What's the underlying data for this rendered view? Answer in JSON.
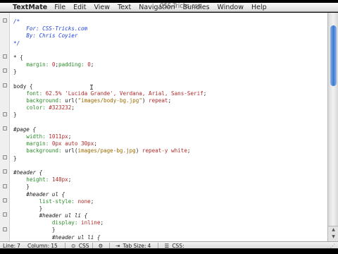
{
  "menubar": {
    "apple_glyph": "",
    "app_name": "TextMate",
    "items": [
      "File",
      "Edit",
      "View",
      "Text",
      "Navigation",
      "Bundles",
      "Window",
      "Help"
    ],
    "window_title": "CSS-Tricks.css"
  },
  "code_lines": [
    [
      {
        "t": "/*",
        "c": "cm"
      }
    ],
    [
      {
        "t": "    For: CSS-Tricks.com",
        "c": "cm"
      }
    ],
    [
      {
        "t": "    By: Chris Coyier",
        "c": "cm"
      }
    ],
    [
      {
        "t": "*/",
        "c": "cm"
      }
    ],
    [],
    [
      {
        "t": "* {",
        "c": "sel"
      }
    ],
    [
      {
        "t": "    margin: ",
        "c": "prop"
      },
      {
        "t": "0",
        "c": "val"
      },
      {
        "t": ";",
        "c": "plain"
      },
      {
        "t": "padding: ",
        "c": "prop"
      },
      {
        "t": "0",
        "c": "val"
      },
      {
        "t": ";",
        "c": "plain"
      }
    ],
    [
      {
        "t": "}",
        "c": "plain"
      }
    ],
    [],
    [
      {
        "t": "body {",
        "c": "sel"
      }
    ],
    [
      {
        "t": "    font: ",
        "c": "prop"
      },
      {
        "t": "62.5% 'Lucida Grande', Verdana, Arial, Sans-Serif",
        "c": "val"
      },
      {
        "t": ";",
        "c": "plain"
      }
    ],
    [
      {
        "t": "    background: ",
        "c": "prop"
      },
      {
        "t": "url(",
        "c": "plain"
      },
      {
        "t": "\"images/body-bg.jpg\"",
        "c": "str"
      },
      {
        "t": ") ",
        "c": "plain"
      },
      {
        "t": "repeat",
        "c": "val"
      },
      {
        "t": ";",
        "c": "plain"
      }
    ],
    [
      {
        "t": "    color: ",
        "c": "prop"
      },
      {
        "t": "#323232",
        "c": "val"
      },
      {
        "t": ";",
        "c": "plain"
      }
    ],
    [
      {
        "t": "}",
        "c": "plain"
      }
    ],
    [],
    [
      {
        "t": "#page {",
        "c": "selid"
      }
    ],
    [
      {
        "t": "    width: ",
        "c": "prop"
      },
      {
        "t": "1011px",
        "c": "val"
      },
      {
        "t": ";",
        "c": "plain"
      }
    ],
    [
      {
        "t": "    margin: ",
        "c": "prop"
      },
      {
        "t": "0px auto 30px",
        "c": "val"
      },
      {
        "t": ";",
        "c": "plain"
      }
    ],
    [
      {
        "t": "    background: ",
        "c": "prop"
      },
      {
        "t": "url(",
        "c": "plain"
      },
      {
        "t": "images/page-bg.jpg",
        "c": "str"
      },
      {
        "t": ") ",
        "c": "plain"
      },
      {
        "t": "repeat-y white",
        "c": "val"
      },
      {
        "t": ";",
        "c": "plain"
      }
    ],
    [
      {
        "t": "}",
        "c": "plain"
      }
    ],
    [],
    [
      {
        "t": "#header {",
        "c": "selid"
      }
    ],
    [
      {
        "t": "    height: ",
        "c": "prop"
      },
      {
        "t": "148px",
        "c": "val"
      },
      {
        "t": ";",
        "c": "plain"
      }
    ],
    [
      {
        "t": "    }",
        "c": "plain"
      }
    ],
    [
      {
        "t": "    #header ul {",
        "c": "selid"
      }
    ],
    [
      {
        "t": "        list-style: ",
        "c": "prop"
      },
      {
        "t": "none",
        "c": "val"
      },
      {
        "t": ";",
        "c": "plain"
      }
    ],
    [
      {
        "t": "        }",
        "c": "plain"
      }
    ],
    [
      {
        "t": "        #header ul li {",
        "c": "selid"
      }
    ],
    [
      {
        "t": "            display: ",
        "c": "prop"
      },
      {
        "t": "inline",
        "c": "val"
      },
      {
        "t": ";",
        "c": "plain"
      }
    ],
    [
      {
        "t": "            }",
        "c": "plain"
      }
    ],
    [
      {
        "t": "            #header ul li {",
        "c": "selid"
      }
    ]
  ],
  "ibeam_glyph": "I",
  "statusbar": {
    "line_label": "Line:",
    "line_value": "7",
    "column_label": "Column:",
    "column_value": "15",
    "language": "CSS",
    "tab_size_label": "Tab Size:",
    "tab_size_value": "4",
    "symbol_value": "CSS:",
    "icons": {
      "language": "gear-icon",
      "tab": "tab-icon",
      "symbol": "list-icon"
    }
  },
  "colors": {
    "comment": "#1f3fd8",
    "property": "#2b8c2b",
    "value": "#b02a2a",
    "string": "#9a6a00",
    "scroll_thumb": "#3a78cf"
  }
}
